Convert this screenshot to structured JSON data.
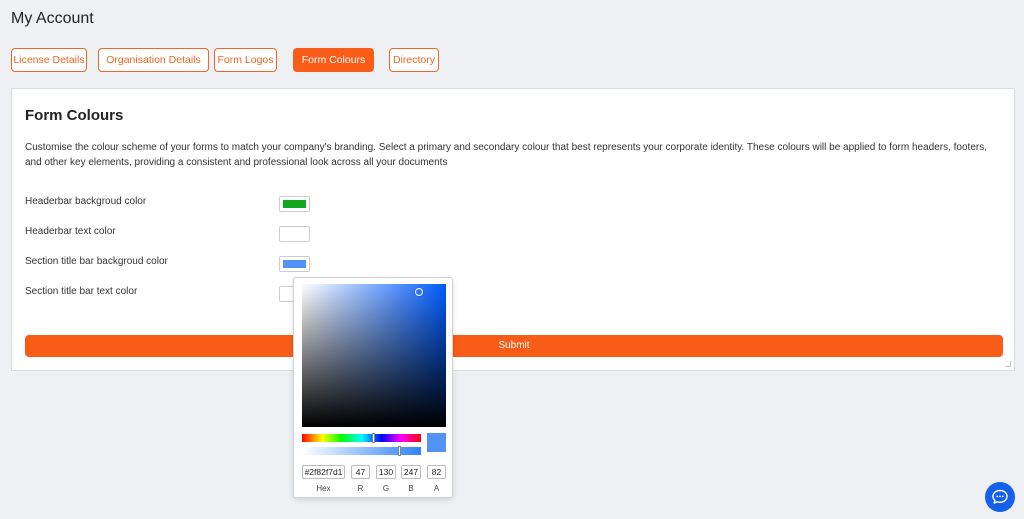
{
  "page": {
    "title": "My Account"
  },
  "tabs": [
    {
      "label": "License Details",
      "active": false
    },
    {
      "label": "Organisation Details",
      "active": false
    },
    {
      "label": "Form Logos",
      "active": false
    },
    {
      "label": "Form Colours",
      "active": true
    },
    {
      "label": "Directory",
      "active": false
    }
  ],
  "form": {
    "title": "Form Colours",
    "description": "Customise the colour scheme of your forms to match your company's branding. Select a primary and secondary colour that best represents your corporate identity. These colours will be applied to form headers, footers, and other key elements, providing a consistent and professional look across all your documents",
    "rows": [
      {
        "label": "Headerbar backgroud color",
        "color": "#0fa820"
      },
      {
        "label": "Headerbar text color",
        "color": "#ffffff"
      },
      {
        "label": "Section title bar backgroud color",
        "color": "#5392f5"
      },
      {
        "label": "Section title bar text color",
        "color": "#ffffff"
      }
    ],
    "submit_label": "Submit"
  },
  "picker": {
    "hex": "#2f82f7d1",
    "r": "47",
    "g": "130",
    "b": "247",
    "a": "82",
    "labels": {
      "hex": "Hex",
      "r": "R",
      "g": "G",
      "b": "B",
      "a": "A"
    }
  },
  "colors": {
    "accent": "#f95c16",
    "chat": "#1560e8"
  },
  "icons": {
    "chat": "chat-bubble-icon"
  }
}
